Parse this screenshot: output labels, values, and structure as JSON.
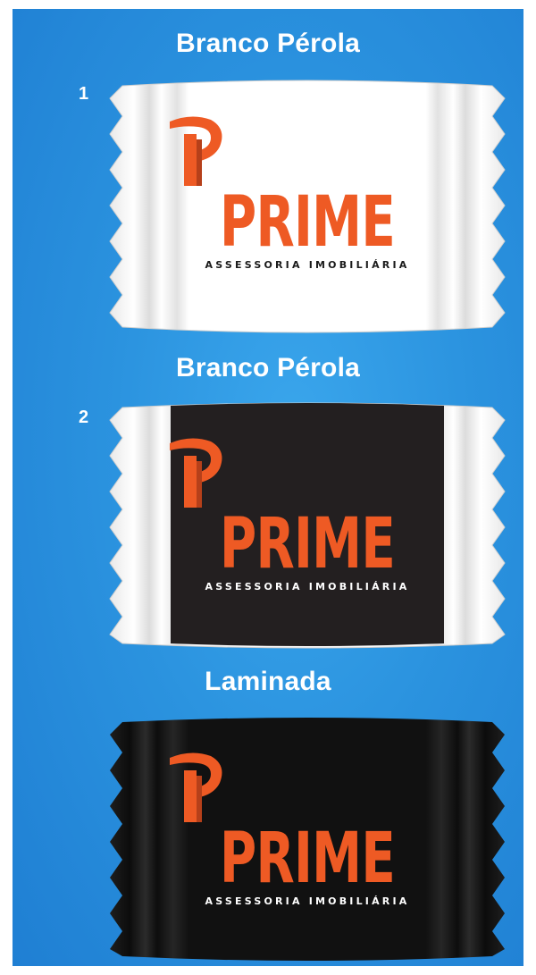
{
  "variants": [
    {
      "title": "Branco Pérola",
      "number": "1",
      "wrapper_color": "#ffffff",
      "panel_color": "#ffffff",
      "sub_color": "#1a1a1a"
    },
    {
      "title": "Branco Pérola",
      "number": "2",
      "wrapper_color": "#ffffff",
      "panel_color": "#231f20",
      "sub_color": "#ffffff"
    },
    {
      "title": "Laminada",
      "number": "",
      "wrapper_color": "#111111",
      "panel_color": "#111111",
      "sub_color": "#ffffff"
    }
  ],
  "logo": {
    "brand": "PRIME",
    "tagline": "ASSESSORIA IMOBILIÁRIA",
    "brand_color": "#ee5a24"
  }
}
